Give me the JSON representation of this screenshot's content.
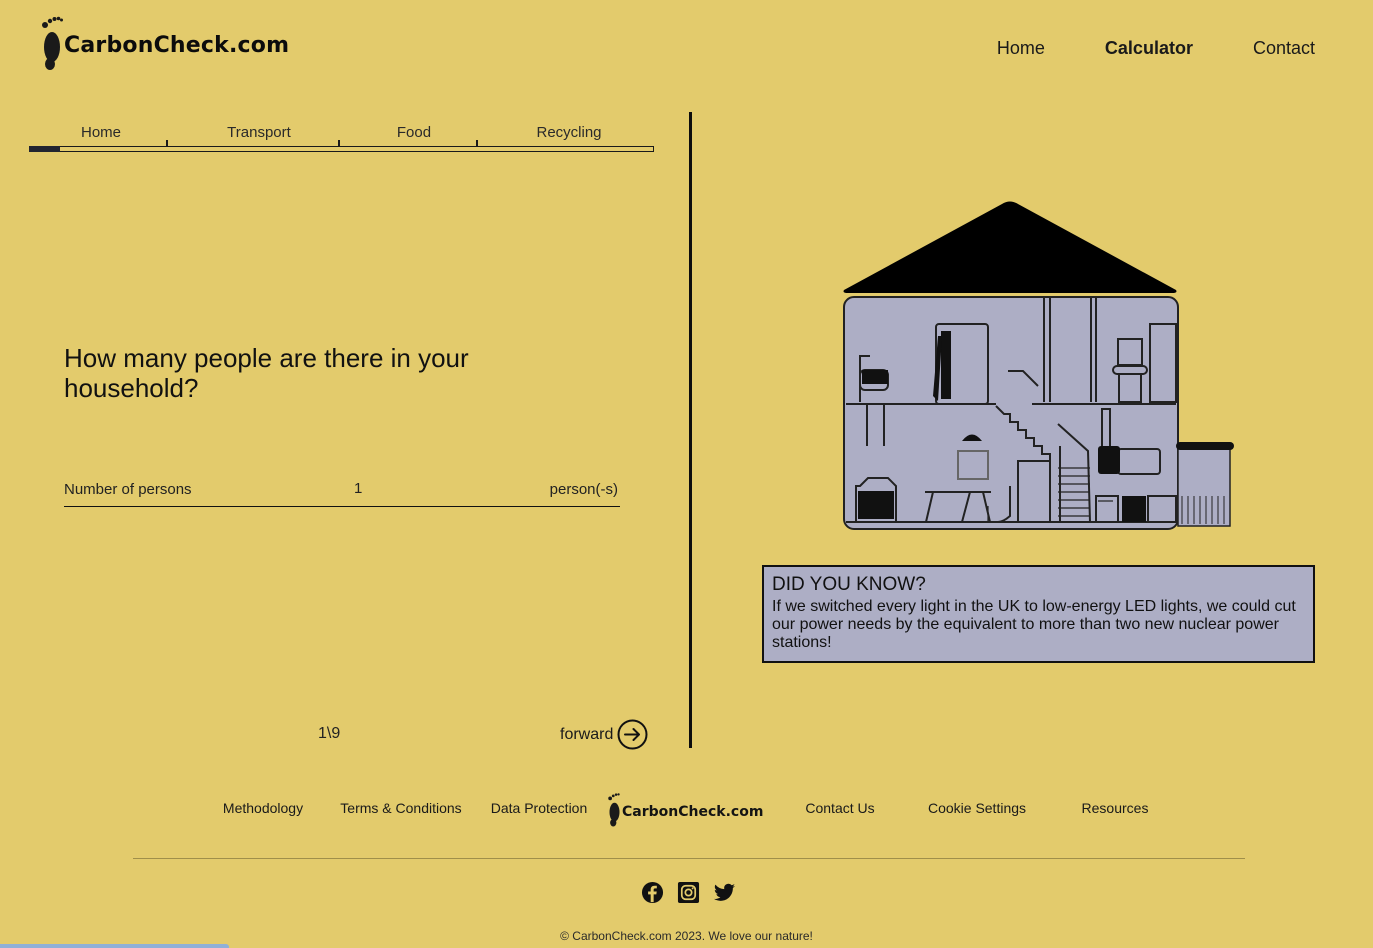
{
  "header": {
    "brand": "CarbonCheck.com",
    "nav": [
      {
        "label": "Home",
        "active": false
      },
      {
        "label": "Calculator",
        "active": true
      },
      {
        "label": "Contact",
        "active": false
      }
    ]
  },
  "steps": {
    "items": [
      "Home",
      "Transport",
      "Food",
      "Recycling"
    ],
    "progress_fraction": 0.05
  },
  "question": {
    "text": "How many people are there in your household?",
    "field_label": "Number of persons",
    "value": "1",
    "unit": "person(-s)"
  },
  "pager": {
    "text": "1\\9",
    "forward_label": "forward"
  },
  "did_you_know": {
    "title": "DID YOU KNOW?",
    "text": "If we switched every light in the UK to low-energy LED lights, we could cut our power needs by the equivalent to more than two new nuclear power stations!"
  },
  "footer": {
    "links_left": [
      "Methodology",
      "Terms & Conditions",
      "Data Protection"
    ],
    "brand": "CarbonCheck.com",
    "links_right": [
      "Contact Us",
      "Cookie Settings",
      "Resources"
    ],
    "social": [
      "facebook-icon",
      "instagram-icon",
      "twitter-icon"
    ],
    "copyright": "© CarbonCheck.com 2023. We love our nature!"
  },
  "colors": {
    "background": "#e3cb6c",
    "card": "#adaec5",
    "ink": "#111111"
  }
}
